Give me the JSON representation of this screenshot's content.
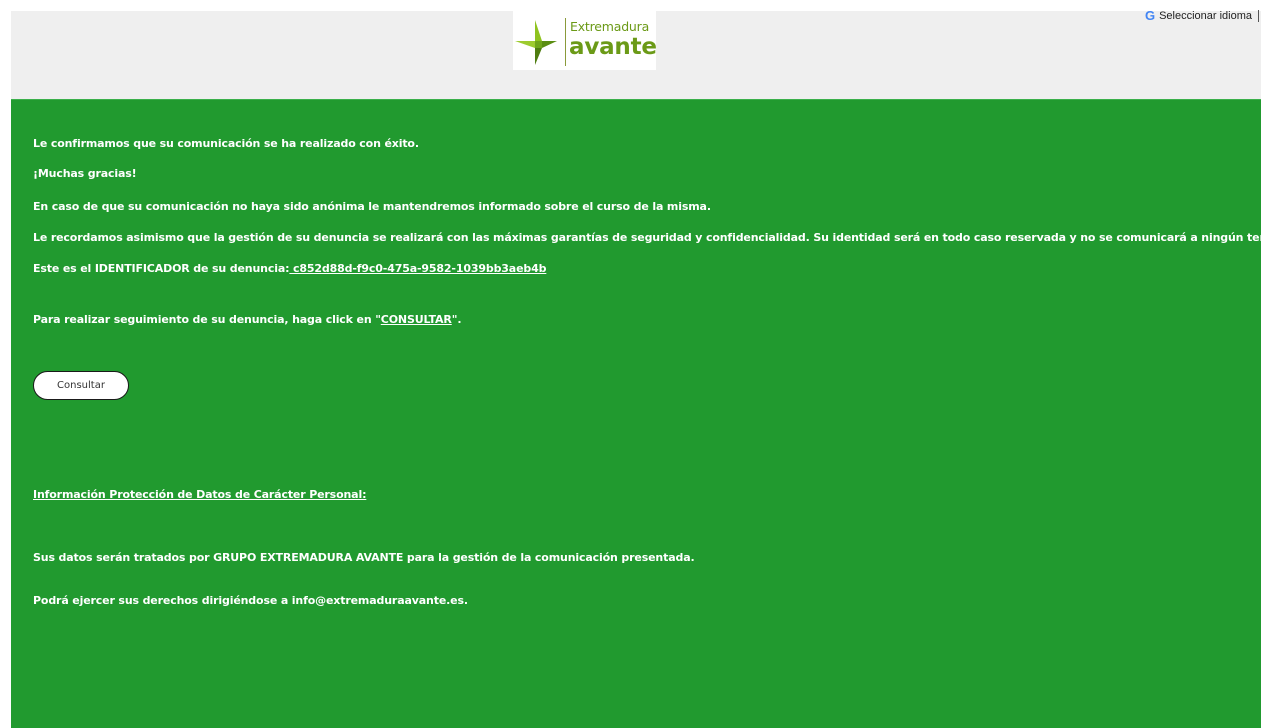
{
  "header": {
    "logo": {
      "line1": "Extremadura",
      "line2": "avante",
      "brand_color": "#6b9a17"
    },
    "translate": {
      "icon": "google-g-icon",
      "label": "Seleccionar idioma"
    }
  },
  "main": {
    "background": "#219a2f",
    "confirmation": "Le confirmamos que su comunicación se ha realizado con éxito.",
    "thanks": "¡Muchas gracias!",
    "informed": "En caso de que su comunicación no haya sido anónima le mantendremos informado sobre el curso de la misma.",
    "reminder": "Le recordamos asimismo que la gestión de su denuncia se realizará con las máximas garantías de seguridad y confidencialidad. Su identidad será en todo caso reservada y no se comunicará a ningún tercero.",
    "identifier_label": "Este es el IDENTIFICADOR de su denuncia:",
    "identifier_value": " c852d88d-f9c0-475a-9582-1039bb3aeb4b",
    "followup_prefix": "Para realizar seguimiento de su denuncia, haga click en \"",
    "followup_link": "CONSULTAR",
    "followup_suffix": "\".",
    "consult_button": "Consultar",
    "privacy_heading": "Información Protección de Datos de Carácter Personal:",
    "privacy_text1": "Sus datos serán tratados por GRUPO EXTREMADURA AVANTE para la gestión de la comunicación presentada.",
    "privacy_text2": "Podrá ejercer sus derechos dirigiéndose a info@extremaduraavante.es."
  }
}
